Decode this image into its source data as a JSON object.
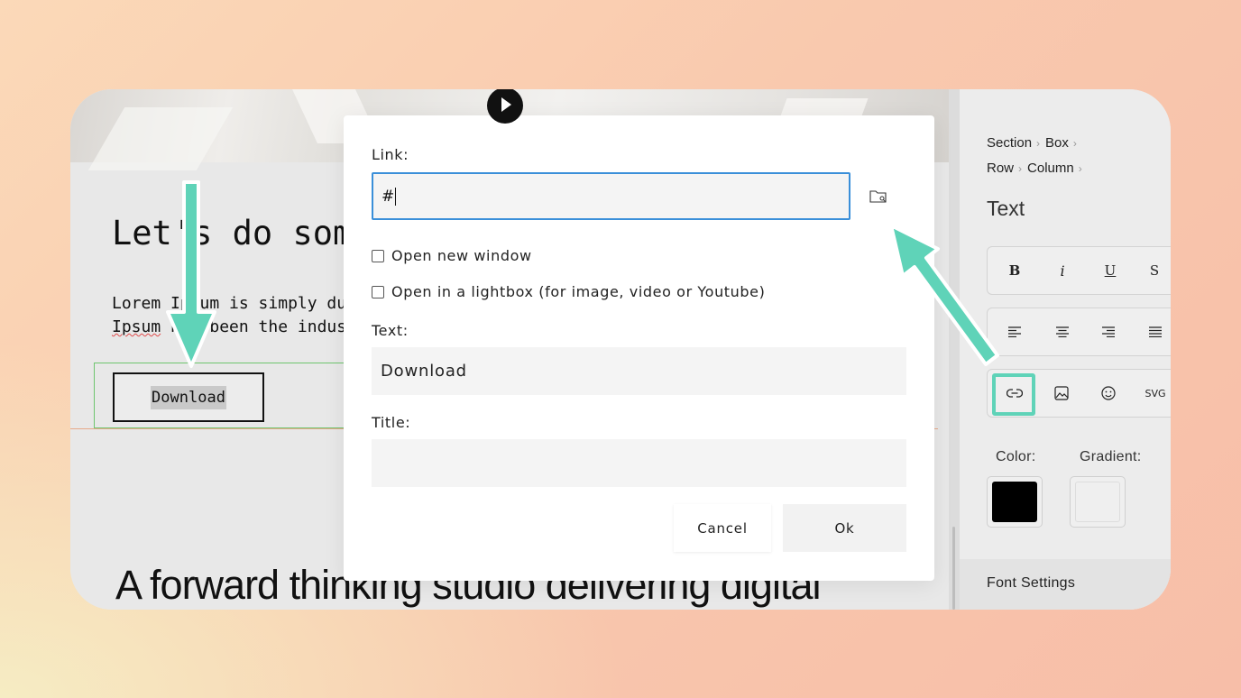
{
  "canvas": {
    "heading": "Let's do some",
    "lorem_line1": "Lorem Ipsum is simply du",
    "lorem_line2_word": "Ipsum",
    "lorem_line2_rest": " has been the indus",
    "download_button": "Download",
    "big_heading": "A forward thinking studio delivering digital"
  },
  "modal": {
    "link_label": "Link:",
    "link_value": "#",
    "open_new_window": "Open new window",
    "open_lightbox": "Open in a lightbox (for image, video or Youtube)",
    "text_label": "Text:",
    "text_value": "Download",
    "title_label": "Title:",
    "title_value": "",
    "cancel": "Cancel",
    "ok": "Ok"
  },
  "panel": {
    "breadcrumbs": [
      "Section",
      "Box",
      "Row",
      "Column"
    ],
    "title": "Text",
    "format_tools": [
      "B",
      "i",
      "U",
      "S"
    ],
    "insert_tools": [
      "link-icon",
      "image-icon",
      "emoji-icon",
      "SVG"
    ],
    "color_label": "Color:",
    "gradient_label": "Gradient:",
    "color_value": "#000000",
    "font_settings": "Font Settings"
  },
  "annotations": {
    "arrow_color": "#5fd3b8"
  }
}
